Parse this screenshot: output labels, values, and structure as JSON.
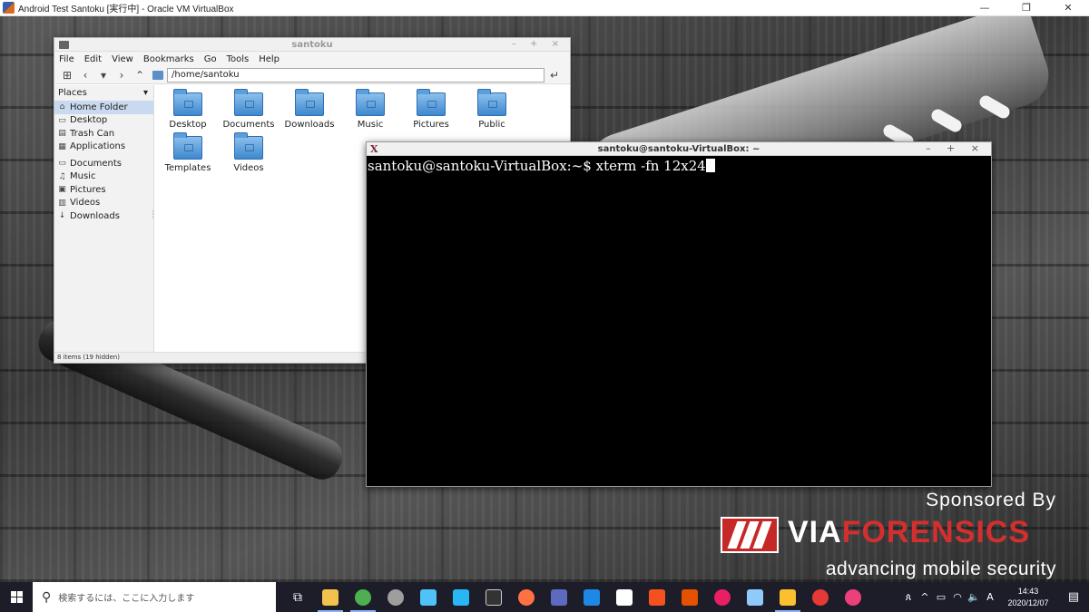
{
  "host_window": {
    "title": "Android Test Santoku [実行中] - Oracle VM VirtualBox",
    "controls": {
      "minimize": "—",
      "restore": "❐",
      "close": "✕"
    }
  },
  "file_manager": {
    "title": "santoku",
    "controls": "– + ×",
    "menu": [
      "File",
      "Edit",
      "View",
      "Bookmarks",
      "Go",
      "Tools",
      "Help"
    ],
    "toolbar": {
      "new_tab": "⊞",
      "back": "‹",
      "history": "▾",
      "forward": "›",
      "up": "⌃",
      "go": "↵"
    },
    "path": "/home/santoku",
    "sidebar": {
      "header": "Places",
      "header_toggle": "▾",
      "places": [
        {
          "label": "Home Folder",
          "icon": "⌂",
          "icon_name": "home-icon"
        },
        {
          "label": "Desktop",
          "icon": "▭",
          "icon_name": "desktop-icon"
        },
        {
          "label": "Trash Can",
          "icon": "▤",
          "icon_name": "trash-icon"
        },
        {
          "label": "Applications",
          "icon": "▦",
          "icon_name": "applications-icon"
        }
      ],
      "bookmarks": [
        {
          "label": "Documents",
          "icon": "▭",
          "icon_name": "documents-icon"
        },
        {
          "label": "Music",
          "icon": "♫",
          "icon_name": "music-icon"
        },
        {
          "label": "Pictures",
          "icon": "▣",
          "icon_name": "pictures-icon"
        },
        {
          "label": "Videos",
          "icon": "▥",
          "icon_name": "videos-icon"
        },
        {
          "label": "Downloads",
          "icon": "↓",
          "icon_name": "downloads-icon"
        }
      ]
    },
    "folders": [
      "Desktop",
      "Documents",
      "Downloads",
      "Music",
      "Pictures",
      "Public",
      "Templates",
      "Videos"
    ],
    "status": "8 items (19 hidden)"
  },
  "xterm": {
    "title": "santoku@santoku-VirtualBox: ~",
    "controls": "– + ×",
    "icon": "X",
    "prompt": "santoku@santoku-VirtualBox:~$ ",
    "command": "xterm -fn 12x24"
  },
  "sponsor": {
    "heading": "Sponsored By",
    "brand_a": "VIA",
    "brand_b": "FORENSICS",
    "tagline": "advancing mobile security",
    "brand_color": "#d32f2f"
  },
  "taskbar": {
    "search_placeholder": "検索するには、ここに入力します",
    "search_icon": "⚲",
    "task_view_icon": "⧉",
    "pinned_apps": [
      {
        "name": "explorer",
        "color": "#f2c14e"
      },
      {
        "name": "chrome",
        "color": "#4caf50"
      },
      {
        "name": "app-3",
        "color": "#9e9e9e"
      },
      {
        "name": "app-4",
        "color": "#4fc3f7"
      },
      {
        "name": "remote-desktop",
        "color": "#29b6f6"
      },
      {
        "name": "terminal",
        "color": "#333333"
      },
      {
        "name": "firefox",
        "color": "#ff7043"
      },
      {
        "name": "teams",
        "color": "#5c6bc0"
      },
      {
        "name": "wireshark",
        "color": "#1e88e5"
      },
      {
        "name": "app-10",
        "color": "#ffffff"
      },
      {
        "name": "app-11",
        "color": "#f4511e"
      },
      {
        "name": "app-12",
        "color": "#e65100"
      },
      {
        "name": "slack",
        "color": "#e91e63"
      },
      {
        "name": "virtualbox",
        "color": "#90caf9"
      },
      {
        "name": "app-15",
        "color": "#fbc02d"
      },
      {
        "name": "app-16",
        "color": "#e53935"
      },
      {
        "name": "app-17",
        "color": "#ec407a"
      }
    ],
    "tray": {
      "people": "ጰ",
      "chevron": "^",
      "battery": "▭",
      "wifi": "◠",
      "volume": "🔈",
      "ime": "A"
    },
    "time": "14:43",
    "date": "2020/12/07",
    "notifications": "▤"
  }
}
